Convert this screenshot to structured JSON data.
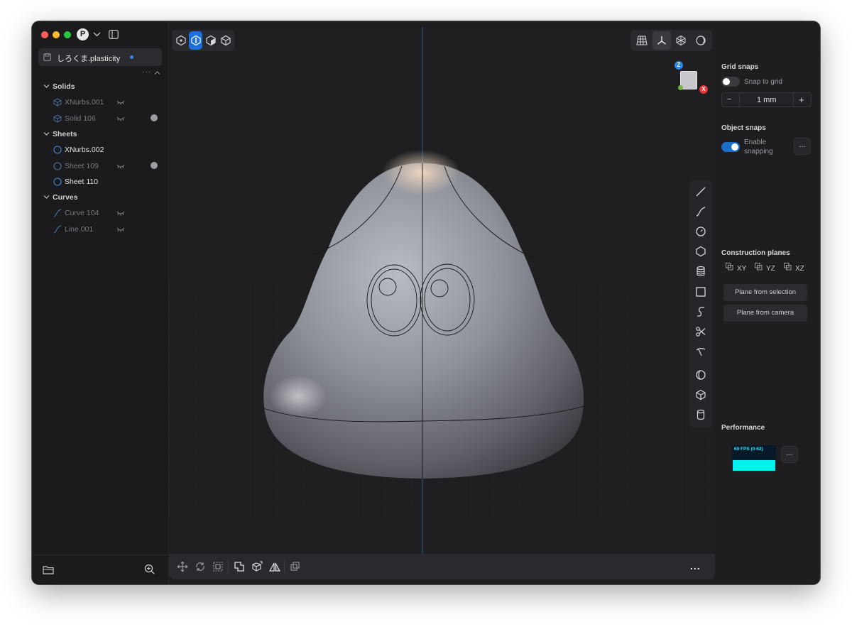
{
  "window": {
    "traffic_colors": [
      "#ff5f57",
      "#febc2e",
      "#28c840"
    ],
    "user_initial": "P"
  },
  "file_tab": {
    "name": "しろくま.plasticity"
  },
  "outliner": {
    "groups": [
      {
        "label": "Solids",
        "items": [
          {
            "name": "XNurbs.001",
            "hidden": true,
            "dot": false,
            "icon": "solid-icon"
          },
          {
            "name": "Solid 106",
            "hidden": true,
            "dot": true,
            "icon": "solid-icon"
          }
        ]
      },
      {
        "label": "Sheets",
        "items": [
          {
            "name": "XNurbs.002",
            "hidden": false,
            "dot": false,
            "icon": "sheet-icon"
          },
          {
            "name": "Sheet 109",
            "hidden": true,
            "dot": true,
            "icon": "sheet-icon"
          },
          {
            "name": "Sheet 110",
            "hidden": false,
            "dot": false,
            "icon": "sheet-icon"
          }
        ]
      },
      {
        "label": "Curves",
        "items": [
          {
            "name": "Curve 104",
            "hidden": true,
            "dot": false,
            "icon": "curve-icon"
          },
          {
            "name": "Line.001",
            "hidden": true,
            "dot": false,
            "icon": "curve-icon"
          }
        ]
      }
    ]
  },
  "viewport": {
    "gizmo": {
      "z": "Z",
      "x": "X"
    },
    "accent": "#1e6fd9"
  },
  "panel": {
    "grid_snaps": {
      "title": "Grid snaps",
      "snap_to_grid_label": "Snap to grid",
      "snap_to_grid_on": false,
      "minus": "−",
      "plus": "+",
      "size": "1 mm"
    },
    "object_snaps": {
      "title": "Object snaps",
      "enable_label_1": "Enable",
      "enable_label_2": "snapping",
      "enabled": true,
      "more": "..."
    },
    "construction_planes": {
      "title": "Construction planes",
      "planes": [
        "XY",
        "YZ",
        "XZ"
      ],
      "from_selection": "Plane from selection",
      "from_camera": "Plane from camera"
    },
    "performance": {
      "title": "Performance",
      "fps_text": "60 FPS (0-62)",
      "more": "..."
    }
  },
  "bottom_more": "..."
}
